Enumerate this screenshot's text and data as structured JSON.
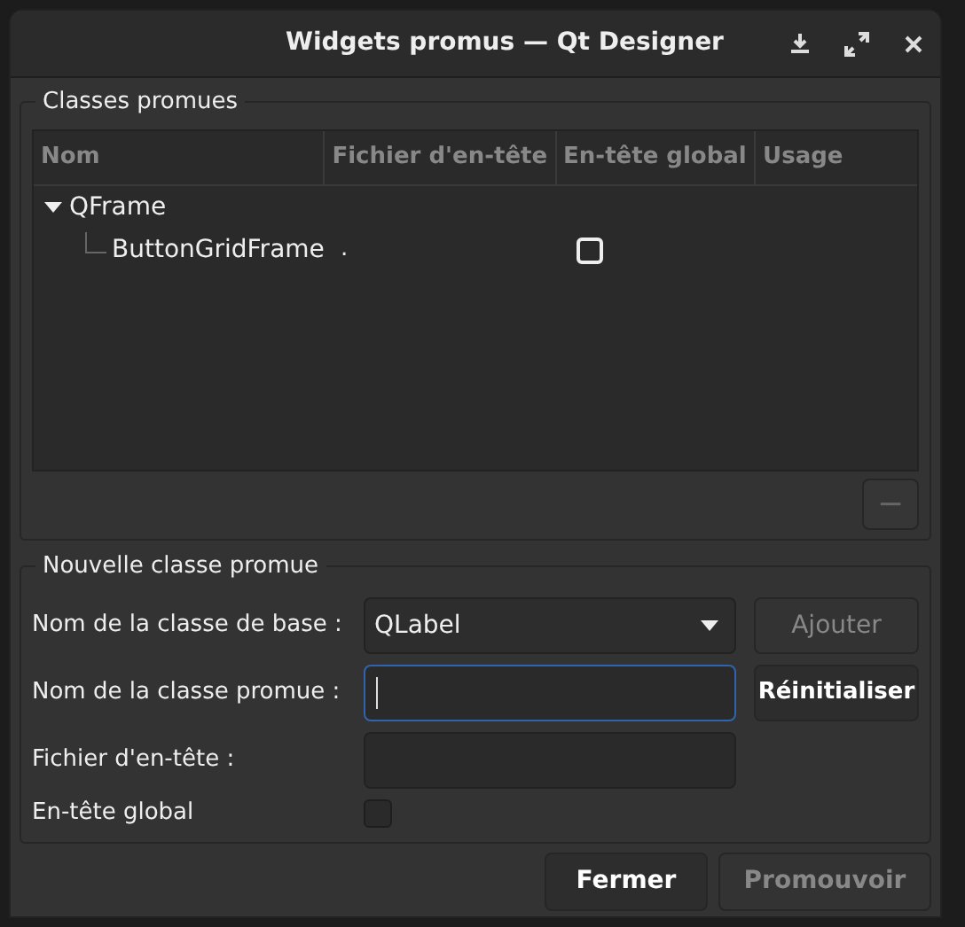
{
  "window": {
    "title": "Widgets promus — Qt Designer"
  },
  "promoted_classes": {
    "title": "Classes promues",
    "columns": [
      "Nom",
      "Fichier d'en-tête",
      "En-tête global",
      "Usage"
    ],
    "rows": [
      {
        "name": "QFrame",
        "expanded": true,
        "children": [
          {
            "name": "ButtonGridFrame",
            "header_file": ".",
            "global_include": false
          }
        ]
      }
    ],
    "remove_button": {
      "label": "−",
      "disabled": true
    }
  },
  "new_class": {
    "title": "Nouvelle classe promue",
    "base_class": {
      "label": "Nom de la classe de base :",
      "value": "QLabel"
    },
    "promoted_name": {
      "label": "Nom de la classe promue :",
      "focused": true
    },
    "header_file": {
      "label": "Fichier d'en-tête :"
    },
    "global_include": {
      "label": "En-tête global",
      "checked": false
    },
    "add_button": {
      "label": "Ajouter",
      "disabled": true
    },
    "reset_button": {
      "label": "Réinitialiser",
      "disabled": false
    }
  },
  "buttons": [
    {
      "label": "Fermer",
      "disabled": false
    },
    {
      "label": "Promouvoir",
      "disabled": true
    }
  ]
}
